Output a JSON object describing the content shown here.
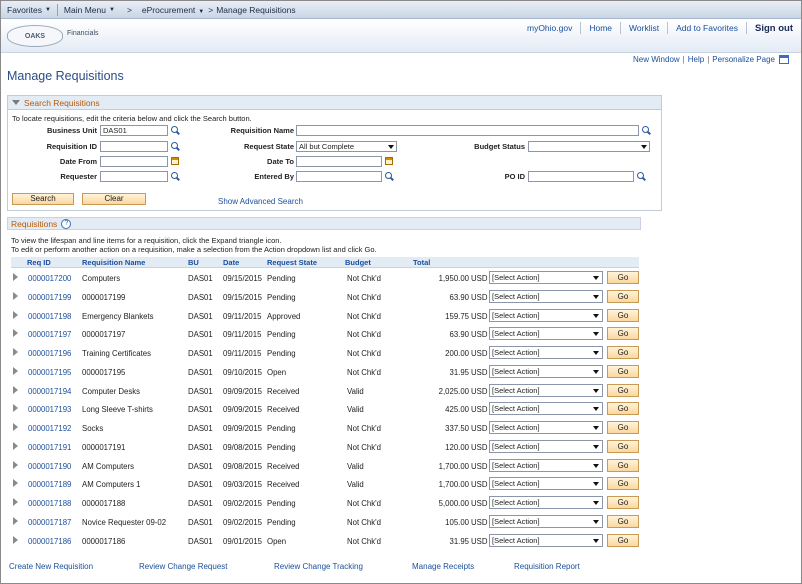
{
  "topnav": {
    "favorites": "Favorites",
    "main_menu": "Main Menu",
    "crumb1": "eProcurement",
    "crumb_sep": ">",
    "crumb2": "Manage Requisitions"
  },
  "header": {
    "logo": "OAKS",
    "logo_sub": "Financials",
    "links": [
      "myOhio.gov",
      "Home",
      "Worklist",
      "Add to Favorites"
    ],
    "signout": "Sign out"
  },
  "pagelinks": {
    "new_window": "New Window",
    "help": "Help",
    "personalize": "Personalize Page",
    "sep": "|"
  },
  "page_title": "Manage Requisitions",
  "search": {
    "header": "Search Requisitions",
    "hint": "To locate requisitions, edit the criteria below and click the Search button.",
    "business_unit_label": "Business Unit",
    "business_unit_value": "DAS01",
    "requisition_name_label": "Requisition Name",
    "requisition_name_value": "",
    "requisition_id_label": "Requisition ID",
    "requisition_id_value": "",
    "request_state_label": "Request State",
    "request_state_value": "All but Complete",
    "budget_status_label": "Budget Status",
    "budget_status_value": "",
    "date_from_label": "Date From",
    "date_from_value": "",
    "date_to_label": "Date To",
    "date_to_value": "",
    "requester_label": "Requester",
    "requester_value": "",
    "entered_by_label": "Entered By",
    "entered_by_value": "",
    "po_id_label": "PO ID",
    "po_id_value": "",
    "search_button": "Search",
    "clear_button": "Clear",
    "advanced_link": "Show Advanced Search"
  },
  "requisitions": {
    "header": "Requisitions",
    "help_icon": "?",
    "instruction1": "To view the lifespan and line items for a requisition, click the Expand triangle icon.",
    "instruction2": "To edit or perform another action on a requisition, make a selection from the Action dropdown list and click Go.",
    "columns": {
      "req_id": "Req ID",
      "name": "Requisition Name",
      "bu": "BU",
      "date": "Date",
      "state": "Request State",
      "budget": "Budget",
      "total": "Total"
    },
    "action_placeholder": "[Select Action]",
    "go_label": "Go",
    "rows": [
      {
        "id": "0000017200",
        "name": "Computers",
        "bu": "DAS01",
        "date": "09/15/2015",
        "state": "Pending",
        "budget": "Not Chk'd",
        "total": "1,950.00",
        "cur": "USD"
      },
      {
        "id": "0000017199",
        "name": "0000017199",
        "bu": "DAS01",
        "date": "09/15/2015",
        "state": "Pending",
        "budget": "Not Chk'd",
        "total": "63.90",
        "cur": "USD"
      },
      {
        "id": "0000017198",
        "name": "Emergency Blankets",
        "bu": "DAS01",
        "date": "09/11/2015",
        "state": "Approved",
        "budget": "Not Chk'd",
        "total": "159.75",
        "cur": "USD"
      },
      {
        "id": "0000017197",
        "name": "0000017197",
        "bu": "DAS01",
        "date": "09/11/2015",
        "state": "Pending",
        "budget": "Not Chk'd",
        "total": "63.90",
        "cur": "USD"
      },
      {
        "id": "0000017196",
        "name": "Training Certificates",
        "bu": "DAS01",
        "date": "09/11/2015",
        "state": "Pending",
        "budget": "Not Chk'd",
        "total": "200.00",
        "cur": "USD"
      },
      {
        "id": "0000017195",
        "name": "0000017195",
        "bu": "DAS01",
        "date": "09/10/2015",
        "state": "Open",
        "budget": "Not Chk'd",
        "total": "31.95",
        "cur": "USD"
      },
      {
        "id": "0000017194",
        "name": "Computer Desks",
        "bu": "DAS01",
        "date": "09/09/2015",
        "state": "Received",
        "budget": "Valid",
        "total": "2,025.00",
        "cur": "USD"
      },
      {
        "id": "0000017193",
        "name": "Long Sleeve T-shirts",
        "bu": "DAS01",
        "date": "09/09/2015",
        "state": "Received",
        "budget": "Valid",
        "total": "425.00",
        "cur": "USD"
      },
      {
        "id": "0000017192",
        "name": "Socks",
        "bu": "DAS01",
        "date": "09/09/2015",
        "state": "Pending",
        "budget": "Not Chk'd",
        "total": "337.50",
        "cur": "USD"
      },
      {
        "id": "0000017191",
        "name": "0000017191",
        "bu": "DAS01",
        "date": "09/08/2015",
        "state": "Pending",
        "budget": "Not Chk'd",
        "total": "120.00",
        "cur": "USD"
      },
      {
        "id": "0000017190",
        "name": "AM Computers",
        "bu": "DAS01",
        "date": "09/08/2015",
        "state": "Received",
        "budget": "Valid",
        "total": "1,700.00",
        "cur": "USD"
      },
      {
        "id": "0000017189",
        "name": "AM Computers 1",
        "bu": "DAS01",
        "date": "09/03/2015",
        "state": "Received",
        "budget": "Valid",
        "total": "1,700.00",
        "cur": "USD"
      },
      {
        "id": "0000017188",
        "name": "0000017188",
        "bu": "DAS01",
        "date": "09/02/2015",
        "state": "Pending",
        "budget": "Not Chk'd",
        "total": "5,000.00",
        "cur": "USD"
      },
      {
        "id": "0000017187",
        "name": "Novice Requester 09-02",
        "bu": "DAS01",
        "date": "09/02/2015",
        "state": "Pending",
        "budget": "Not Chk'd",
        "total": "105.00",
        "cur": "USD"
      },
      {
        "id": "0000017186",
        "name": "0000017186",
        "bu": "DAS01",
        "date": "09/01/2015",
        "state": "Open",
        "budget": "Not Chk'd",
        "total": "31.95",
        "cur": "USD"
      }
    ]
  },
  "bottom_links": [
    "Create New Requisition",
    "Review Change Request",
    "Review Change Tracking",
    "Manage Receipts",
    "Requisition Report"
  ]
}
